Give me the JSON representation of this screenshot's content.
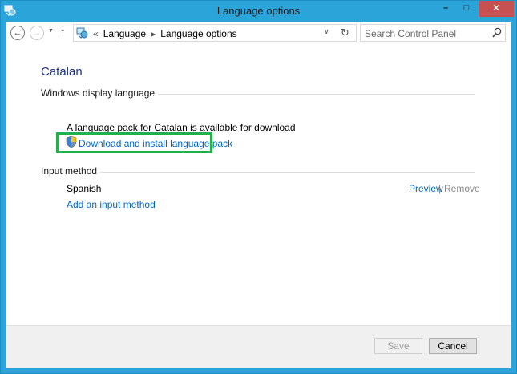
{
  "window": {
    "title": "Language options",
    "minimize_glyph": "–",
    "maximize_glyph": "□",
    "close_glyph": "✕"
  },
  "navigation": {
    "back_glyph": "←",
    "forward_glyph": "→",
    "recent_glyph": "▼",
    "up_glyph": "↑",
    "breadcrumb_overflow": "«",
    "breadcrumb": [
      "Language",
      "Language options"
    ],
    "breadcrumb_separator": "▶",
    "dropdown_glyph": "∨",
    "refresh_glyph": "↻",
    "search_placeholder": "Search Control Panel"
  },
  "main": {
    "heading": "Catalan",
    "display_language": {
      "label": "Windows display language",
      "message": "A language pack for Catalan is available for download",
      "download_link": "Download and install language pack"
    },
    "input_method": {
      "label": "Input method",
      "items": [
        {
          "name": "Spanish",
          "preview_label": "Preview",
          "separator": "|",
          "remove_label": "Remove"
        }
      ],
      "add_link": "Add an input method"
    }
  },
  "footer": {
    "save_label": "Save",
    "cancel_label": "Cancel"
  },
  "colors": {
    "titlebar": "#2ba4da",
    "heading": "#1e3287",
    "link": "#0066cc",
    "highlight": "#21b14b"
  }
}
